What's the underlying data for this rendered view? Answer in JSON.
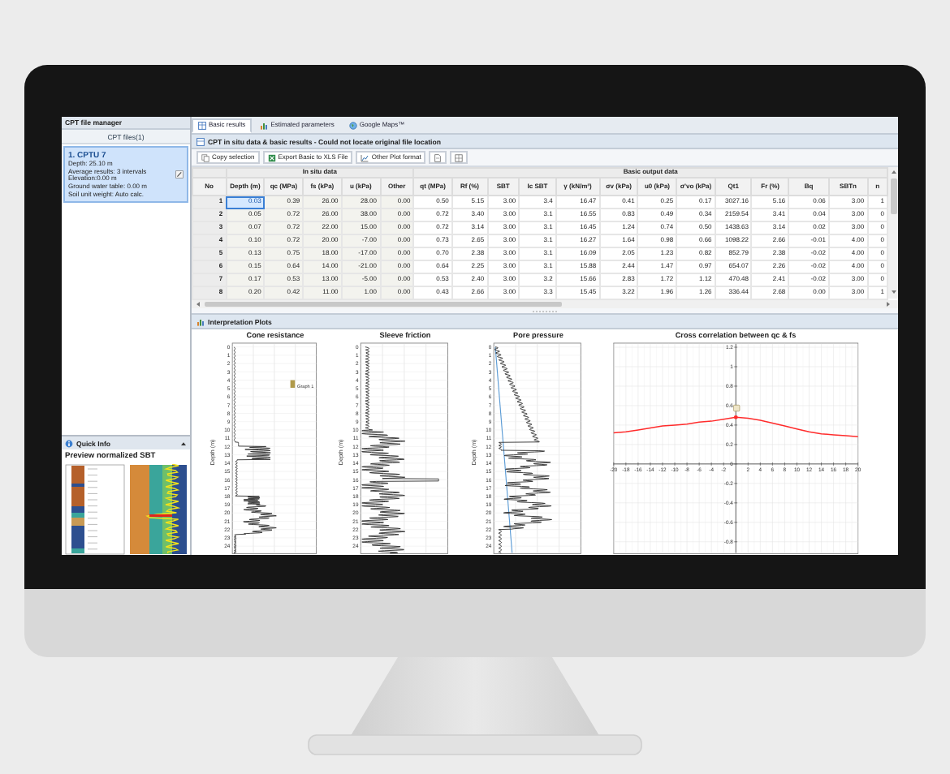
{
  "file_manager": {
    "title": "CPT file manager",
    "subtitle": "CPT files(1)",
    "files": [
      {
        "name": "1. CPTU 7",
        "selected": true,
        "details": [
          "Depth: 25.10 m",
          "Average results: 3 intervals",
          "Elevation:0.00 m",
          "Ground water table: 0.00 m",
          "Soil unit weight: Auto calc."
        ]
      }
    ]
  },
  "quick_info": {
    "title": "Quick Info",
    "preview_title": "Preview normalized SBT"
  },
  "tabs": [
    {
      "label": "Basic results",
      "kind": "table",
      "selected": true
    },
    {
      "label": "Estimated parameters",
      "kind": "params",
      "selected": false
    },
    {
      "label": "Google Maps™",
      "kind": "globe",
      "selected": false
    }
  ],
  "results": {
    "title": "CPT in situ data & basic results - Could not locate original file location",
    "toolbar": [
      {
        "label": "Copy selection",
        "kind": "copy"
      },
      {
        "label": "Export Basic to XLS File",
        "kind": "export"
      },
      {
        "label": "Other Plot format",
        "kind": "plot"
      }
    ],
    "table": {
      "header_groups": [
        {
          "kind": "blank",
          "shaded": true,
          "columns": [
            "No"
          ]
        },
        {
          "kind": "titled",
          "label": "In situ data",
          "shaded": true,
          "columns": [
            "Depth (m)",
            "qc (MPa)",
            "fs (kPa)",
            "u (kPa)",
            "Other"
          ]
        },
        {
          "kind": "titled",
          "label": "Basic output data",
          "shaded": false,
          "columns": [
            "qt (MPa)",
            "Rf (%)",
            "SBT",
            "Ic SBT",
            "γ (kN/m³)",
            "σv (kPa)",
            "u0 (kPa)",
            "σ'vo (kPa)",
            "Qt1",
            "Fr (%)",
            "Bq",
            "SBTn",
            "n"
          ]
        }
      ],
      "rows": [
        {
          "cells": [
            "1",
            "0.03",
            "0.39",
            "26.00",
            "28.00",
            "0.00",
            "0.50",
            "5.15",
            "3.00",
            "3.4",
            "16.47",
            "0.41",
            "0.25",
            "0.17",
            "3027.16",
            "5.16",
            "0.06",
            "3.00",
            "1"
          ],
          "selected": [
            false,
            true,
            false,
            false,
            false,
            false,
            false,
            false,
            false,
            false,
            false,
            false,
            false,
            false,
            false,
            false,
            false,
            false,
            false
          ]
        },
        {
          "cells": [
            "2",
            "0.05",
            "0.72",
            "26.00",
            "38.00",
            "0.00",
            "0.72",
            "3.40",
            "3.00",
            "3.1",
            "16.55",
            "0.83",
            "0.49",
            "0.34",
            "2159.54",
            "3.41",
            "0.04",
            "3.00",
            "0"
          ],
          "selected": [
            false,
            false,
            false,
            false,
            false,
            false,
            false,
            false,
            false,
            false,
            false,
            false,
            false,
            false,
            false,
            false,
            false,
            false,
            false
          ]
        },
        {
          "cells": [
            "3",
            "0.07",
            "0.72",
            "22.00",
            "15.00",
            "0.00",
            "0.72",
            "3.14",
            "3.00",
            "3.1",
            "16.45",
            "1.24",
            "0.74",
            "0.50",
            "1438.63",
            "3.14",
            "0.02",
            "3.00",
            "0"
          ],
          "selected": [
            false,
            false,
            false,
            false,
            false,
            false,
            false,
            false,
            false,
            false,
            false,
            false,
            false,
            false,
            false,
            false,
            false,
            false,
            false
          ]
        },
        {
          "cells": [
            "4",
            "0.10",
            "0.72",
            "20.00",
            "-7.00",
            "0.00",
            "0.73",
            "2.65",
            "3.00",
            "3.1",
            "16.27",
            "1.64",
            "0.98",
            "0.66",
            "1098.22",
            "2.66",
            "-0.01",
            "4.00",
            "0"
          ],
          "selected": [
            false,
            false,
            false,
            false,
            false,
            false,
            false,
            false,
            false,
            false,
            false,
            false,
            false,
            false,
            false,
            false,
            false,
            false,
            false
          ]
        },
        {
          "cells": [
            "5",
            "0.13",
            "0.75",
            "18.00",
            "-17.00",
            "0.00",
            "0.70",
            "2.38",
            "3.00",
            "3.1",
            "16.09",
            "2.05",
            "1.23",
            "0.82",
            "852.79",
            "2.38",
            "-0.02",
            "4.00",
            "0"
          ],
          "selected": [
            false,
            false,
            false,
            false,
            false,
            false,
            false,
            false,
            false,
            false,
            false,
            false,
            false,
            false,
            false,
            false,
            false,
            false,
            false
          ]
        },
        {
          "cells": [
            "6",
            "0.15",
            "0.64",
            "14.00",
            "-21.00",
            "0.00",
            "0.64",
            "2.25",
            "3.00",
            "3.1",
            "15.88",
            "2.44",
            "1.47",
            "0.97",
            "654.07",
            "2.26",
            "-0.02",
            "4.00",
            "0"
          ],
          "selected": [
            false,
            false,
            false,
            false,
            false,
            false,
            false,
            false,
            false,
            false,
            false,
            false,
            false,
            false,
            false,
            false,
            false,
            false,
            false
          ]
        },
        {
          "cells": [
            "7",
            "0.17",
            "0.53",
            "13.00",
            "-5.00",
            "0.00",
            "0.53",
            "2.40",
            "3.00",
            "3.2",
            "15.66",
            "2.83",
            "1.72",
            "1.12",
            "470.48",
            "2.41",
            "-0.02",
            "3.00",
            "0"
          ],
          "selected": [
            false,
            false,
            false,
            false,
            false,
            false,
            false,
            false,
            false,
            false,
            false,
            false,
            false,
            false,
            false,
            false,
            false,
            false,
            false
          ]
        },
        {
          "cells": [
            "8",
            "0.20",
            "0.42",
            "11.00",
            "1.00",
            "0.00",
            "0.43",
            "2.66",
            "3.00",
            "3.3",
            "15.45",
            "3.22",
            "1.96",
            "1.26",
            "336.44",
            "2.68",
            "0.00",
            "3.00",
            "1"
          ],
          "selected": [
            false,
            false,
            false,
            false,
            false,
            false,
            false,
            false,
            false,
            false,
            false,
            false,
            false,
            false,
            false,
            false,
            false,
            false,
            false
          ]
        }
      ]
    }
  },
  "plots": {
    "title": "Interpretation Plots",
    "depth_plots": [
      {
        "kind": "cone",
        "title": "Cone resistance",
        "ylabel": "Depth (m)",
        "legend": "Graph 1",
        "ticks": [
          "0",
          "1",
          "2",
          "3",
          "4",
          "5",
          "6",
          "7",
          "8",
          "9",
          "10",
          "11",
          "12",
          "13",
          "14",
          "15",
          "16",
          "17",
          "18",
          "19",
          "20",
          "21",
          "22",
          "23",
          "24"
        ]
      },
      {
        "kind": "sleeve",
        "title": "Sleeve friction",
        "ylabel": "Depth (m)",
        "ticks": [
          "0",
          "1",
          "2",
          "3",
          "4",
          "5",
          "6",
          "7",
          "8",
          "9",
          "10",
          "11",
          "12",
          "13",
          "14",
          "15",
          "16",
          "17",
          "18",
          "19",
          "20",
          "21",
          "22",
          "23",
          "24"
        ]
      },
      {
        "kind": "pore",
        "title": "Pore pressure",
        "ylabel": "Depth (m)",
        "ticks": [
          "0",
          "1",
          "2",
          "3",
          "4",
          "5",
          "6",
          "7",
          "8",
          "9",
          "10",
          "11",
          "12",
          "13",
          "14",
          "15",
          "16",
          "17",
          "18",
          "19",
          "20",
          "21",
          "22",
          "23",
          "24"
        ]
      }
    ],
    "correlation": {
      "chart_data": {
        "type": "line",
        "title": "Cross correlation between qc & fs",
        "grid": true,
        "x": [
          -20,
          -18,
          -16,
          -14,
          -12,
          -10,
          -8,
          -6,
          -4,
          -2,
          0,
          2,
          4,
          6,
          8,
          10,
          12,
          14,
          16,
          18,
          20
        ],
        "series": [
          {
            "color": "#ff2b2b",
            "values": [
              0.32,
              0.33,
              0.35,
              0.37,
              0.39,
              0.4,
              0.41,
              0.43,
              0.44,
              0.46,
              0.48,
              0.47,
              0.45,
              0.42,
              0.39,
              0.36,
              0.33,
              0.31,
              0.3,
              0.29,
              0.28
            ]
          }
        ],
        "xlim": [
          -20,
          20
        ],
        "ylim": [
          -0.93,
          1.25
        ],
        "xticks": [
          -20,
          -18,
          -16,
          -14,
          -12,
          -10,
          -8,
          -6,
          -4,
          -2,
          2,
          4,
          6,
          8,
          10,
          12,
          14,
          16,
          18,
          20
        ],
        "yticks": [
          1.2,
          1,
          0.8,
          0.6,
          0.4,
          0.2,
          0,
          -0.2,
          -0.4,
          -0.6,
          -0.8
        ]
      }
    }
  }
}
